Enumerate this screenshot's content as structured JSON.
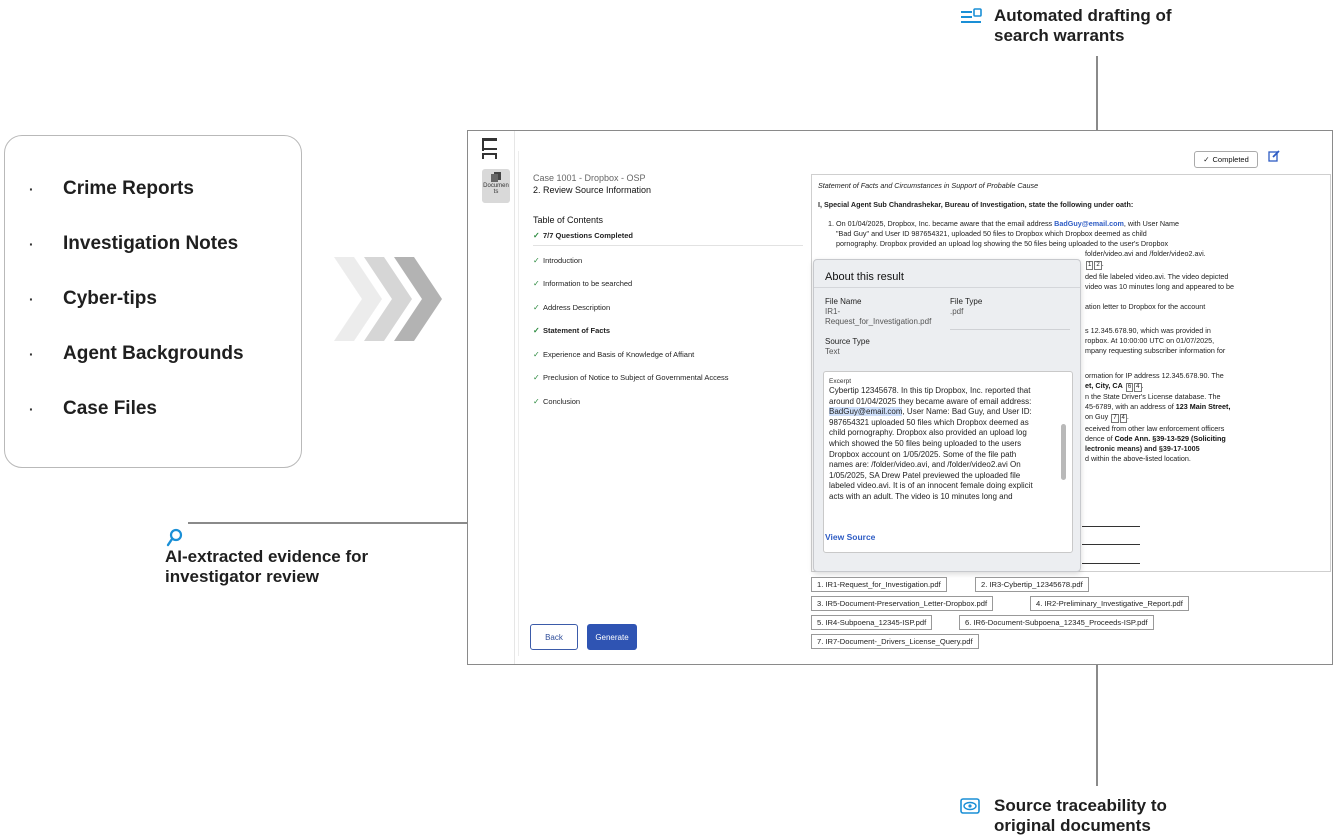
{
  "inputs": {
    "items": [
      "Crime Reports",
      "Investigation Notes",
      "Cyber-tips",
      "Agent Backgrounds",
      "Case Files"
    ],
    "bullet": "·"
  },
  "callouts": {
    "top": [
      "Automated drafting of",
      "search warrants"
    ],
    "left": [
      "AI-extracted evidence for",
      "investigator review"
    ],
    "bottom": [
      "Source traceability to",
      "original documents"
    ]
  },
  "app": {
    "rail_docs_label": "Documen ts",
    "case_title": "Case 1001 - Dropbox - OSP",
    "step_title": "2. Review Source Information",
    "toc_heading": "Table of Contents",
    "toc": [
      {
        "label": "7/7 Questions Completed",
        "bold": true
      },
      {
        "label": "Introduction",
        "bold": false
      },
      {
        "label": "Information to be searched",
        "bold": false
      },
      {
        "label": "Address Description",
        "bold": false
      },
      {
        "label": "Statement of Facts",
        "bold": true
      },
      {
        "label": "Experience and Basis of Knowledge of Affiant",
        "bold": false
      },
      {
        "label": "Preclusion of Notice to Subject of Governmental Access",
        "bold": false
      },
      {
        "label": "Conclusion",
        "bold": false
      }
    ],
    "back_label": "Back",
    "generate_label": "Generate",
    "completed_label": "Completed",
    "doc": {
      "heading": "Statement of Facts and Circumstances in Support of Probable Cause",
      "oath": "I, Special Agent Sub Chandrashekar, Bureau of Investigation, state the following under oath:",
      "p1a": "1. On 01/04/2025, Dropbox, Inc. became aware that the email address",
      "p1_email": "BadGuy@email.com",
      "p1b": ", with User Name",
      "p1c": "\"Bad Guy\" and User ID 987654321, uploaded 50 files to Dropbox which Dropbox deemed as child",
      "p1d": "pornography. Dropbox provided an upload log showing the 50 files being uploaded to the user's Dropbox",
      "r1": "folder/video.avi and /folder/video2.avi.",
      "r2": "ded file labeled video.avi. The video depicted",
      "r3": "video was 10 minutes long and appeared to be",
      "r4": "ation letter to Dropbox for the account",
      "r5": "s 12.345.678.90, which was provided in",
      "r6": "ropbox. At 10:00:00 UTC on 01/07/2025,",
      "r7": "mpany requesting subscriber information for",
      "r8": "ormation for IP address 12.345.678.90. The",
      "r9": "et, City, CA",
      "r10": "n the State Driver's License database. The",
      "r11a": "45-6789, with an address of",
      "r11b": "123 Main Street,",
      "r12": "on Guy",
      "r13": "eceived from other law enforcement officers",
      "r14a": "dence of",
      "r14b": "Code Ann. §39-13-529 (Soliciting",
      "r15": "lectronic means) and §39-17-1005",
      "r16": "d within the above-listed location.",
      "fn": [
        "1",
        "2",
        "6",
        "4",
        "7",
        "4"
      ]
    },
    "popup": {
      "title": "About this result",
      "file_name_label": "File Name",
      "file_name_value1": "IR1-",
      "file_name_value2": "Request_for_Investigation.pdf",
      "file_type_label": "File Type",
      "file_type_value": ".pdf",
      "source_type_label": "Source Type",
      "source_type_value": "Text",
      "excerpt_label": "Excerpt",
      "excerpt_lines": [
        "Cybertip 12345678. In this tip Dropbox, Inc. reported that",
        "around 01/04/2025 they became aware of email address:",
        "BadGuy@email.com|, User Name: Bad Guy, and User ID:",
        "987654321 uploaded 50 files which Dropbox deemed as",
        "child pornography. Dropbox also provided an upload log",
        "which showed the 50 files being uploaded to the users",
        "Dropbox account on 1/05/2025. Some of the file path",
        "names are: /folder/video.avi, and /folder/video2.avi On",
        "1/05/2025, SA Drew Patel previewed the uploaded file",
        "labeled video.avi. It is of an innocent female doing explicit",
        "acts with an adult. The video is 10 minutes long and"
      ],
      "view_source": "View Source"
    },
    "sources": [
      "1.  IR1-Request_for_Investigation.pdf",
      "2.  IR3-Cybertip_12345678.pdf",
      "3.  IR5-Document-Preservation_Letter-Dropbox.pdf",
      "4.  IR2-Preliminary_Investigative_Report.pdf",
      "5.  IR4-Subpoena_12345-ISP.pdf",
      "6.  IR6-Document-Subpoena_12345_Proceeds-ISP.pdf",
      "7.  IR7-Document-_Drivers_License_Query.pdf"
    ]
  },
  "colors": {
    "accent": "#1a8fd6",
    "primary_button": "#2f54b3",
    "link": "#2e5cc4"
  }
}
